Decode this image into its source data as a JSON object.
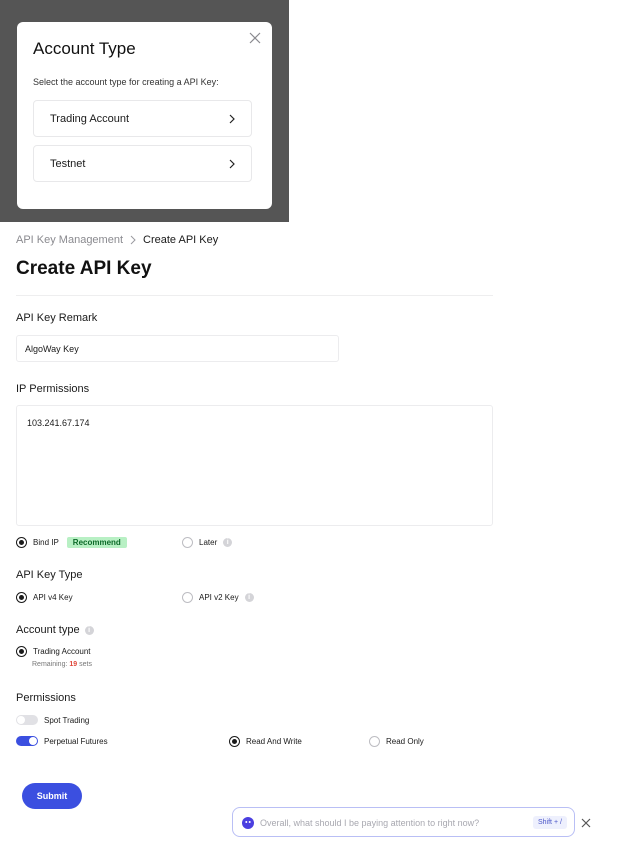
{
  "dialog": {
    "title": "Account Type",
    "description": "Select the account type for creating a API Key:",
    "options": [
      {
        "label": "Trading Account"
      },
      {
        "label": "Testnet"
      }
    ]
  },
  "breadcrumb": {
    "parent": "API Key Management",
    "current": "Create API Key"
  },
  "page_title": "Create API Key",
  "remark": {
    "label": "API Key Remark",
    "value": "AlgoWay Key"
  },
  "ip_permissions": {
    "label": "IP Permissions",
    "value": "103.241.67.174",
    "bind_ip_label": "Bind IP",
    "recommend_badge": "Recommend",
    "later_label": "Later",
    "selected": "bind_ip"
  },
  "key_type": {
    "label": "API Key Type",
    "v4_label": "API v4 Key",
    "v2_label": "API v2 Key",
    "selected": "v4"
  },
  "account_type": {
    "label": "Account type",
    "option_label": "Trading Account",
    "remaining_prefix": "Remaining:",
    "remaining_count": "19",
    "remaining_suffix": "sets"
  },
  "permissions": {
    "label": "Permissions",
    "spot_label": "Spot Trading",
    "spot_enabled": false,
    "futures_label": "Perpetual Futures",
    "futures_enabled": true,
    "read_write_label": "Read And Write",
    "read_only_label": "Read Only",
    "access": "read_write"
  },
  "submit_label": "Submit",
  "assistant": {
    "placeholder": "Overall, what should I be paying attention to right now?",
    "shortcut": "Shift + /"
  },
  "colors": {
    "accent": "#3b4fe0",
    "recommend_bg": "#b8f0c4",
    "remaining_count": "#e0483b",
    "overlay": "#555555"
  },
  "icons": [
    "close-icon",
    "chevron-right-icon",
    "info-icon",
    "assistant-logo-icon"
  ]
}
